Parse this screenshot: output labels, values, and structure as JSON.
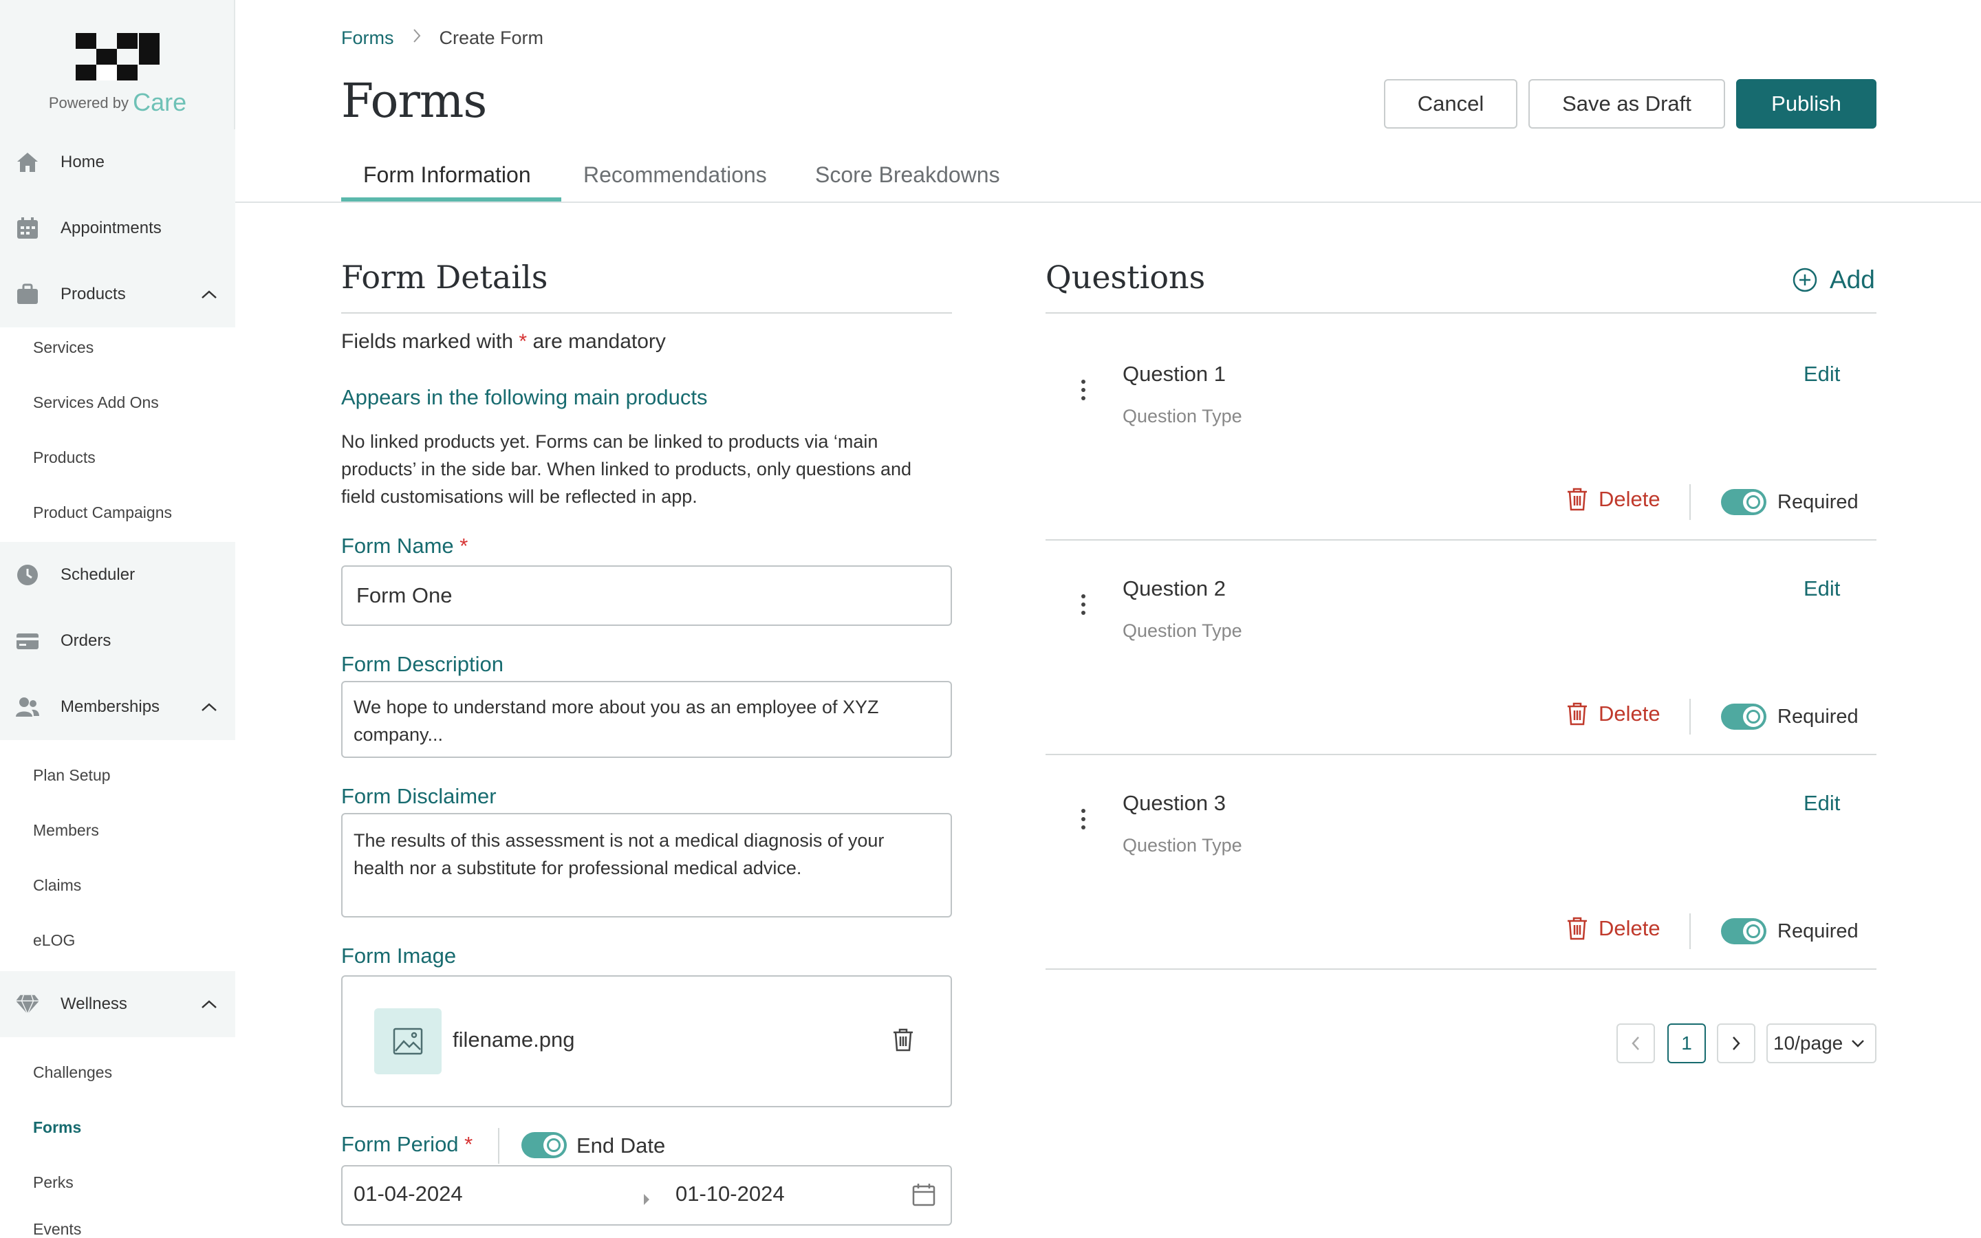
{
  "brand": {
    "powered_by": "Powered by",
    "name": "Care"
  },
  "sidebar": {
    "items": [
      {
        "label": "Home",
        "icon": "home-icon"
      },
      {
        "label": "Appointments",
        "icon": "calendar-icon"
      },
      {
        "label": "Products",
        "icon": "briefcase-icon",
        "expanded": true,
        "children": [
          "Services",
          "Services Add Ons",
          "Products",
          "Product Campaigns"
        ]
      },
      {
        "label": "Scheduler",
        "icon": "clock-icon"
      },
      {
        "label": "Orders",
        "icon": "card-icon"
      },
      {
        "label": "Memberships",
        "icon": "users-icon",
        "expanded": true,
        "children": [
          "Plan Setup",
          "Members",
          "Claims",
          "eLOG"
        ]
      },
      {
        "label": "Wellness",
        "icon": "diamond-icon",
        "expanded": true,
        "children": [
          "Challenges",
          "Forms",
          "Perks",
          "Events"
        ],
        "active_child": "Forms"
      }
    ]
  },
  "breadcrumb": {
    "parent": "Forms",
    "current": "Create Form"
  },
  "page_title": "Forms",
  "actions": {
    "cancel": "Cancel",
    "save_draft": "Save as Draft",
    "publish": "Publish"
  },
  "tabs": [
    {
      "label": "Form Information",
      "active": true
    },
    {
      "label": "Recommendations",
      "active": false
    },
    {
      "label": "Score Breakdowns",
      "active": false
    }
  ],
  "form_details": {
    "title": "Form Details",
    "mandatory_note_prefix": "Fields marked with",
    "mandatory_star": "*",
    "mandatory_note_suffix": "are mandatory",
    "appears_heading": "Appears in the following main products",
    "appears_text_1": "No linked products yet. Forms can be linked to products via ‘main",
    "appears_text_2": "products’ in the side bar. When linked to products, only questions and",
    "appears_text_3": "field customisations will be reflected in app.",
    "name_label": "Form Name",
    "name_value": "Form One",
    "description_label": "Form Description",
    "description_line1": "We hope to understand more about you as an employee of XYZ",
    "description_line2": "company...",
    "disclaimer_label": "Form Disclaimer",
    "disclaimer_line1": "The results of this assessment is not a medical diagnosis of your",
    "disclaimer_line2": "health nor a substitute for professional medical advice.",
    "image_label": "Form Image",
    "image_filename": "filename.png",
    "period_label": "Form Period",
    "end_date_label": "End Date",
    "end_date_enabled": true,
    "start_date": "01-04-2024",
    "end_date": "01-10-2024"
  },
  "questions": {
    "title": "Questions",
    "add_label": "Add",
    "items": [
      {
        "title": "Question 1",
        "type": "Question Type",
        "edit": "Edit",
        "delete": "Delete",
        "required_label": "Required",
        "required": true
      },
      {
        "title": "Question 2",
        "type": "Question Type",
        "edit": "Edit",
        "delete": "Delete",
        "required_label": "Required",
        "required": true
      },
      {
        "title": "Question 3",
        "type": "Question Type",
        "edit": "Edit",
        "delete": "Delete",
        "required_label": "Required",
        "required": true
      }
    ]
  },
  "pagination": {
    "current_page": "1",
    "page_size": "10/page"
  },
  "colors": {
    "primary": "#176b6f",
    "accent": "#5bb8ac",
    "danger": "#c0392b",
    "sidebar_bg": "#f3f6f6"
  }
}
